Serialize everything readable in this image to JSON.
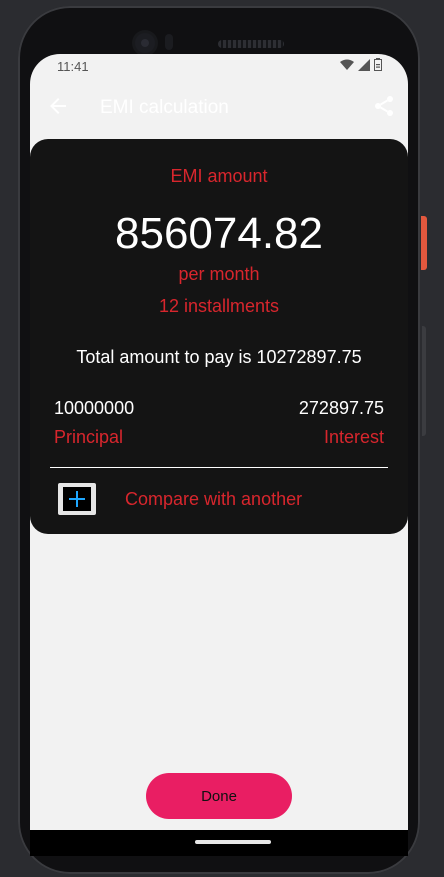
{
  "status_bar": {
    "time": "11:41",
    "icons": [
      "wifi-icon",
      "signal-icon",
      "battery-icon"
    ]
  },
  "app_bar": {
    "title": "EMI calculation",
    "back_icon": "back-arrow-icon",
    "share_icon": "share-icon"
  },
  "result": {
    "emi_label": "EMI amount",
    "emi_value": "856074.82",
    "per_month": "per month",
    "installments": "12 installments",
    "total_text": "Total amount to pay is 10272897.75",
    "principal_value": "10000000",
    "principal_label": "Principal",
    "interest_value": "272897.75",
    "interest_label": "Interest",
    "compare_label": "Compare with another"
  },
  "actions": {
    "done_label": "Done"
  },
  "colors": {
    "accent_red": "#d8262d",
    "button_pink": "#e91e63",
    "card_bg": "#141414",
    "screen_bg": "#f2f2f2"
  }
}
